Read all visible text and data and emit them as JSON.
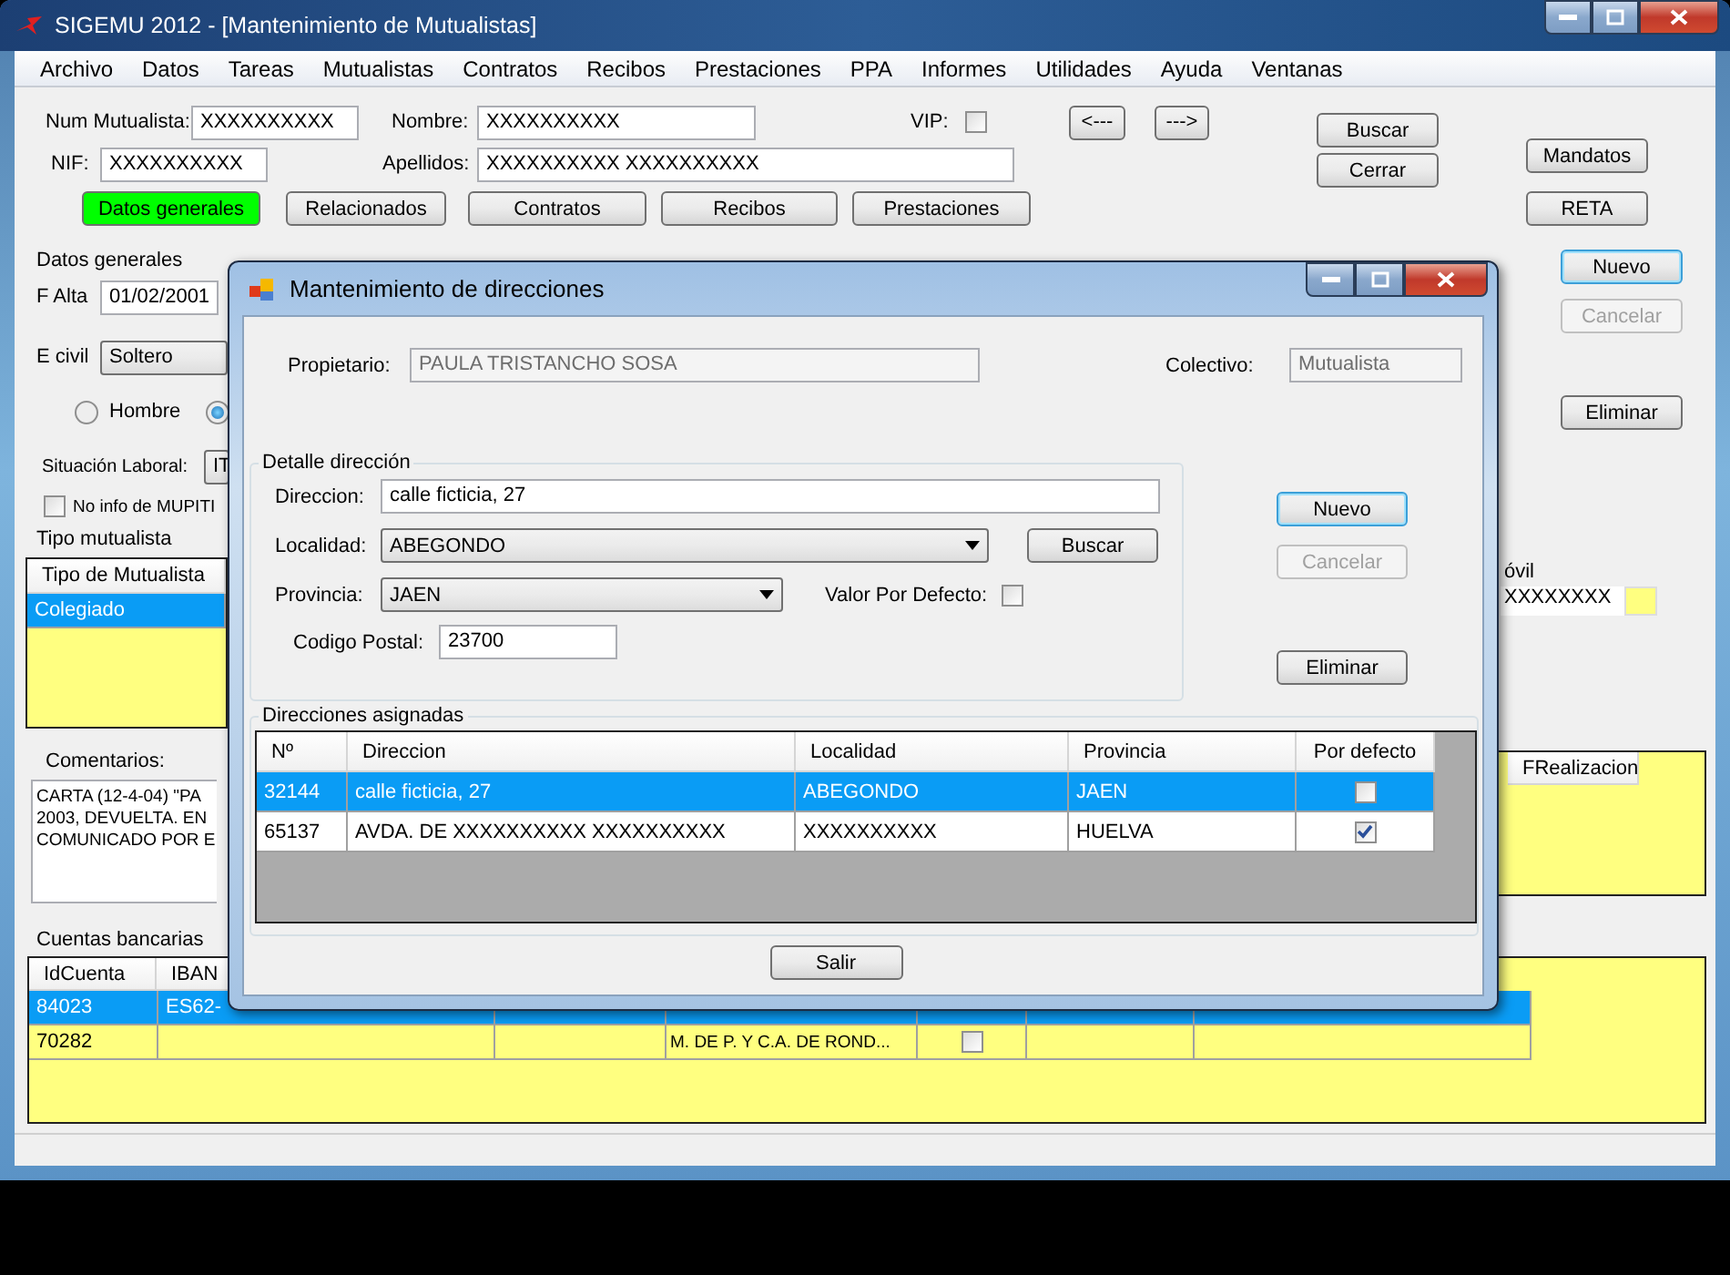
{
  "window": {
    "title": "SIGEMU 2012 - [Mantenimiento de Mutualistas]"
  },
  "menu": [
    "Archivo",
    "Datos",
    "Tareas",
    "Mutualistas",
    "Contratos",
    "Recibos",
    "Prestaciones",
    "PPA",
    "Informes",
    "Utilidades",
    "Ayuda",
    "Ventanas"
  ],
  "header": {
    "num_mutualista": {
      "label": "Num Mutualista:",
      "value": "XXXXXXXXXX"
    },
    "nombre": {
      "label": "Nombre:",
      "value": "XXXXXXXXXX"
    },
    "nif": {
      "label": "NIF:",
      "value": "XXXXXXXXXX"
    },
    "apellidos": {
      "label": "Apellidos:",
      "value": "XXXXXXXXXX XXXXXXXXXX"
    },
    "vip": {
      "label": "VIP:",
      "checked": false
    },
    "nav_buttons": [
      "<---",
      "--->"
    ],
    "search_buttons": [
      "Buscar",
      "Cerrar"
    ],
    "side_buttons": [
      "Mandatos",
      "RETA"
    ],
    "tabs": [
      {
        "label": "Datos generales",
        "selected": true
      },
      {
        "label": "Relacionados",
        "selected": false
      },
      {
        "label": "Contratos",
        "selected": false
      },
      {
        "label": "Recibos",
        "selected": false
      },
      {
        "label": "Prestaciones",
        "selected": false
      }
    ]
  },
  "datos_generales": {
    "title": "Datos generales",
    "f_alta": {
      "label": "F Alta",
      "value": "01/02/2001"
    },
    "e_civil": {
      "label": "E civil",
      "value": "Soltero"
    },
    "sexo": [
      {
        "label": "Hombre",
        "selected": false
      },
      {
        "selected": true
      }
    ],
    "situacion": {
      "label": "Situación Laboral:",
      "value": "IT"
    },
    "mupiti": {
      "label": "No info de MUPITI",
      "checked": false
    }
  },
  "tipo_mutualista": {
    "title": "Tipo mutualista",
    "column": "Tipo de Mutualista",
    "rows": [
      {
        "text": "Colegiado",
        "selected": true
      }
    ]
  },
  "comentarios": {
    "label": "Comentarios:",
    "lines": [
      "CARTA (12-4-04) \"PA",
      "2003, DEVUELTA. EN",
      "COMUNICADO POR E"
    ]
  },
  "right_panel": {
    "buttons": [
      {
        "label": "Nuevo",
        "focused": true,
        "disabled": false
      },
      {
        "label": "Cancelar",
        "focused": false,
        "disabled": true
      },
      {
        "label": "Eliminar",
        "focused": false,
        "disabled": false
      }
    ],
    "movil": {
      "label": "óvil",
      "value": "XXXXXXXX"
    },
    "realizacion_column": "FRealizacion"
  },
  "cuentas": {
    "title": "Cuentas bancarias",
    "columns": [
      "IdCuenta",
      "IBAN"
    ],
    "rows": [
      {
        "id": "84023",
        "iban": "ES62-",
        "selected": true
      },
      {
        "id": "70282",
        "iban": "",
        "entity": "M. DE P. Y C.A. DE ROND...",
        "checked": false,
        "selected": false
      }
    ]
  },
  "dialog": {
    "title": "Mantenimiento de direcciones",
    "propietario": {
      "label": "Propietario:",
      "value": "PAULA TRISTANCHO SOSA"
    },
    "colectivo": {
      "label": "Colectivo:",
      "value": "Mutualista"
    },
    "detalle": {
      "title": "Detalle dirección",
      "direccion": {
        "label": "Direccion:",
        "value": "calle ficticia, 27"
      },
      "localidad": {
        "label": "Localidad:",
        "value": "ABEGONDO"
      },
      "buscar": "Buscar",
      "provincia": {
        "label": "Provincia:",
        "value": "JAEN"
      },
      "defecto": {
        "label": "Valor Por Defecto:",
        "checked": false
      },
      "codigo_postal": {
        "label": "Codigo Postal:",
        "value": "23700"
      }
    },
    "buttons": [
      {
        "label": "Nuevo",
        "focused": true,
        "disabled": false
      },
      {
        "label": "Cancelar",
        "focused": false,
        "disabled": true
      },
      {
        "label": "Eliminar",
        "focused": false,
        "disabled": false
      }
    ],
    "asignadas": {
      "title": "Direcciones asignadas",
      "columns": [
        "Nº",
        "Direccion",
        "Localidad",
        "Provincia",
        "Por defecto"
      ],
      "rows": [
        {
          "num": "32144",
          "direccion": "calle ficticia, 27",
          "localidad": "ABEGONDO",
          "provincia": "JAEN",
          "por_defecto": false,
          "selected": true
        },
        {
          "num": "65137",
          "direccion": "AVDA. DE  XXXXXXXXXX  XXXXXXXXXX",
          "localidad": "XXXXXXXXXX",
          "provincia": "HUELVA",
          "por_defecto": true,
          "selected": false
        }
      ]
    },
    "salir": "Salir"
  }
}
